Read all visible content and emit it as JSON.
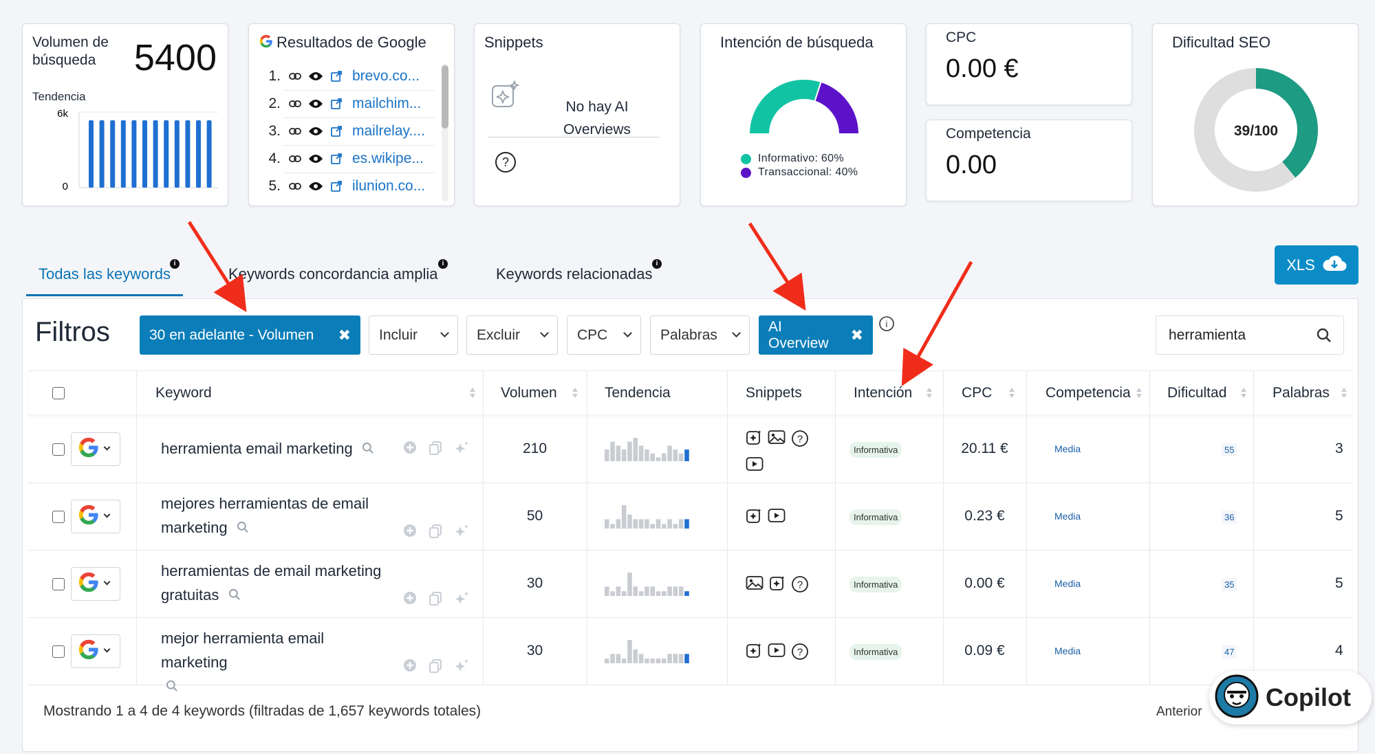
{
  "cards": {
    "volumen": {
      "title": "Volumen de búsqueda",
      "value": "5400",
      "tendencia_label": "Tendencia",
      "y_max": "6k",
      "y_min": "0",
      "bars": [
        1,
        1,
        1,
        1,
        1,
        1,
        1,
        1,
        1,
        1,
        1,
        1
      ]
    },
    "google": {
      "title": "Resultados de Google",
      "results": [
        {
          "n": "1.",
          "domain": "brevo.co..."
        },
        {
          "n": "2.",
          "domain": "mailchim..."
        },
        {
          "n": "3.",
          "domain": "mailrelay...."
        },
        {
          "n": "4.",
          "domain": "es.wikipe..."
        },
        {
          "n": "5.",
          "domain": "ilunion.co..."
        }
      ]
    },
    "snippets": {
      "title": "Snippets",
      "line1": "No hay AI",
      "line2": "Overviews"
    },
    "intencion": {
      "title": "Intención de búsqueda",
      "segments": [
        {
          "label": "Informativo: 60%",
          "value": 60,
          "color": "#12c3a3"
        },
        {
          "label": "Transaccional: 40%",
          "value": 40,
          "color": "#5b12c9"
        }
      ]
    },
    "cpc": {
      "label": "CPC",
      "value": "0.00 €"
    },
    "competencia": {
      "label": "Competencia",
      "value": "0.00"
    },
    "dificultad": {
      "title": "Dificultad SEO",
      "label": "39/100",
      "value": 39,
      "max": 100,
      "color": "#1d9b83"
    }
  },
  "tabs": [
    {
      "label": "Todas las keywords"
    },
    {
      "label": "Keywords concordancia amplia"
    },
    {
      "label": "Keywords relacionadas"
    }
  ],
  "xls_label": "XLS",
  "filters": {
    "title": "Filtros",
    "volume_chip": "30 en adelante - Volumen",
    "incluir": "Incluir",
    "excluir": "Excluir",
    "cpc": "CPC",
    "palabras": "Palabras",
    "ai_chip": "AI Overview",
    "search_value": "herramienta"
  },
  "table": {
    "headers": [
      "Keyword",
      "Volumen",
      "Tendencia",
      "Snippets",
      "Intención",
      "CPC",
      "Competencia",
      "Dificultad",
      "Palabras"
    ],
    "rows": [
      {
        "kw1": "herramienta email marketing",
        "kw2": "",
        "volume": "210",
        "trend": [
          3,
          5,
          4,
          3,
          5,
          6,
          4,
          3,
          2,
          1,
          2,
          4,
          3,
          2,
          3
        ],
        "intent": "Informativa",
        "cpc": "20.11 €",
        "comp": "Media",
        "dif": "55",
        "words": "3",
        "snippets": [
          "ai",
          "image",
          "question",
          "video"
        ]
      },
      {
        "kw1": "mejores herramientas de email",
        "kw2": "marketing",
        "volume": "50",
        "trend": [
          2,
          1,
          2,
          5,
          3,
          2,
          2,
          2,
          1,
          2,
          1,
          2,
          1,
          2,
          2
        ],
        "intent": "Informativa",
        "cpc": "0.23 €",
        "comp": "Media",
        "dif": "36",
        "words": "5",
        "snippets": [
          "ai",
          "video"
        ]
      },
      {
        "kw1": "herramientas de email marketing",
        "kw2": "gratuitas",
        "volume": "30",
        "trend": [
          2,
          1,
          2,
          1,
          5,
          2,
          1,
          2,
          2,
          1,
          1,
          2,
          2,
          2,
          1
        ],
        "intent": "Informativa",
        "cpc": "0.00 €",
        "comp": "Media",
        "dif": "35",
        "words": "5",
        "snippets": [
          "image",
          "ai",
          "question"
        ]
      },
      {
        "kw1": "mejor herramienta email marketing",
        "kw2": "",
        "volume": "30",
        "trend": [
          1,
          2,
          2,
          1,
          5,
          3,
          2,
          1,
          1,
          1,
          1,
          2,
          2,
          2,
          2
        ],
        "intent": "Informativa",
        "cpc": "0.09 €",
        "comp": "Media",
        "dif": "47",
        "words": "4",
        "snippets": [
          "ai",
          "video",
          "question"
        ]
      }
    ]
  },
  "footer": {
    "text": "Mostrando 1 a 4 de 4 keywords (filtradas de 1,657 keywords totales)",
    "prev": "Anterior"
  },
  "copilot_label": "Copilot",
  "colors": {
    "accent": "#0b7db8",
    "bar": "#1f6fd1",
    "arrow": "#f02d1a"
  }
}
